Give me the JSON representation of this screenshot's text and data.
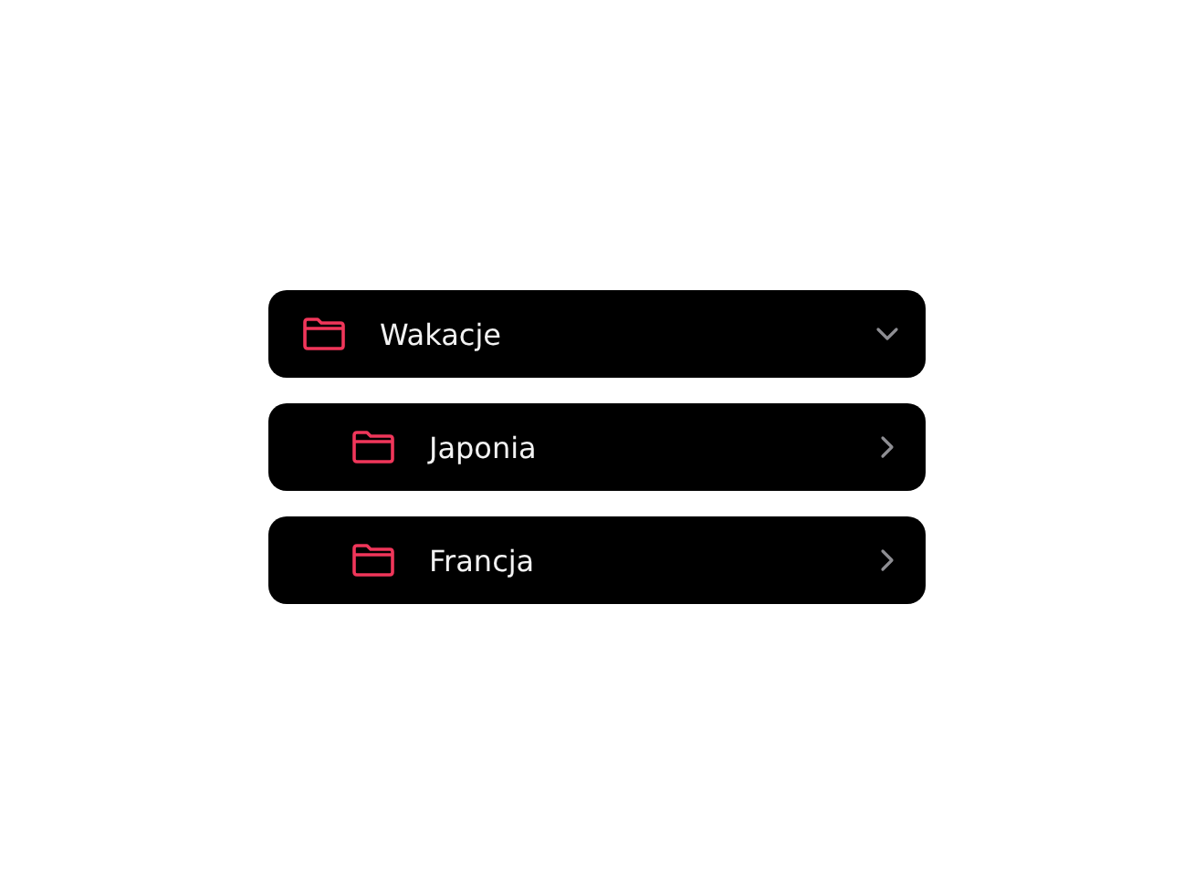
{
  "folders": [
    {
      "name": "Wakacje",
      "expanded": true,
      "children": [
        {
          "name": "Japonia",
          "expanded": false
        },
        {
          "name": "Francja",
          "expanded": false
        }
      ]
    }
  ]
}
